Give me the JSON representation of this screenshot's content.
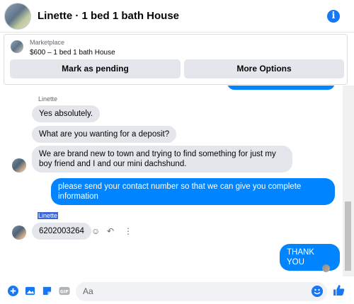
{
  "header": {
    "title": "Linette · 1 bed 1 bath House"
  },
  "marketplace": {
    "label": "Marketplace",
    "listing": "$600 – 1 bed 1 bath House",
    "pending_button": "Mark as pending",
    "more_button": "More Options"
  },
  "messages": [
    {
      "sender": "Linette",
      "text": "Yes absolutely.",
      "direction": "incoming"
    },
    {
      "text": "What are you wanting for a deposit?",
      "direction": "incoming"
    },
    {
      "text": "We are brand new to town and trying to find something for just my boy friend and I and our mini dachshund.",
      "direction": "outgoing"
    },
    {
      "text": "please send your contact number so that we can give you complete information",
      "direction": "outgoing"
    },
    {
      "sender": "Linette",
      "text": "6202003264",
      "direction": "incoming"
    },
    {
      "text": "THANK YOU",
      "direction": "outgoing"
    }
  ],
  "composer": {
    "placeholder": "Aa"
  },
  "colors": {
    "accent": "#0084ff",
    "incoming_bubble": "#e4e6eb",
    "brand": "#1877f2"
  },
  "icons": [
    "info-icon",
    "plus-icon",
    "photo-icon",
    "sticker-icon",
    "gif-icon",
    "emoji-icon",
    "like-icon",
    "react-icon",
    "reply-icon",
    "more-icon"
  ]
}
